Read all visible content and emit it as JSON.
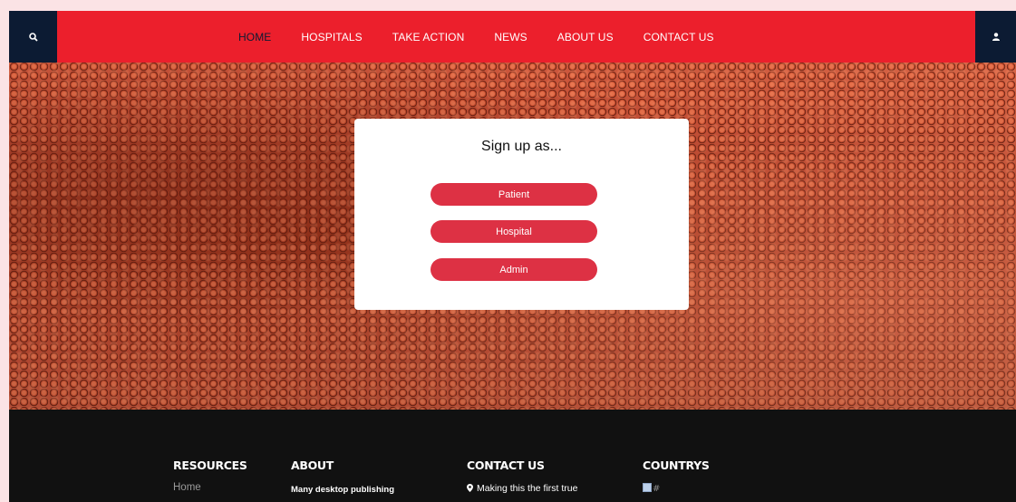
{
  "header": {
    "search_icon": "search-icon",
    "user_icon": "user-icon",
    "nav": [
      {
        "label": "HOME",
        "active": true
      },
      {
        "label": "HOSPITALS"
      },
      {
        "label": "TAKE ACTION"
      },
      {
        "label": "NEWS"
      },
      {
        "label": "ABOUT US"
      },
      {
        "label": "CONTACT US"
      }
    ]
  },
  "signup": {
    "title": "Sign up as...",
    "options": [
      "Patient",
      "Hospital",
      "Admin"
    ]
  },
  "footer": {
    "resources": {
      "heading": "RESOURCES",
      "items": [
        "Home"
      ]
    },
    "about": {
      "heading": "ABOUT",
      "text": "Many desktop publishing"
    },
    "contact": {
      "heading": "CONTACT US",
      "text": "Making this the first true",
      "icon": "map-marker-icon"
    },
    "countries": {
      "heading": "COUNTRYS",
      "image_alt": "#"
    }
  },
  "colors": {
    "primary": "#ec1f2c",
    "dark_navy": "#0c1b33",
    "button": "#dd3144",
    "footer_bg": "#111111",
    "page_bg": "#fbe3e5"
  }
}
